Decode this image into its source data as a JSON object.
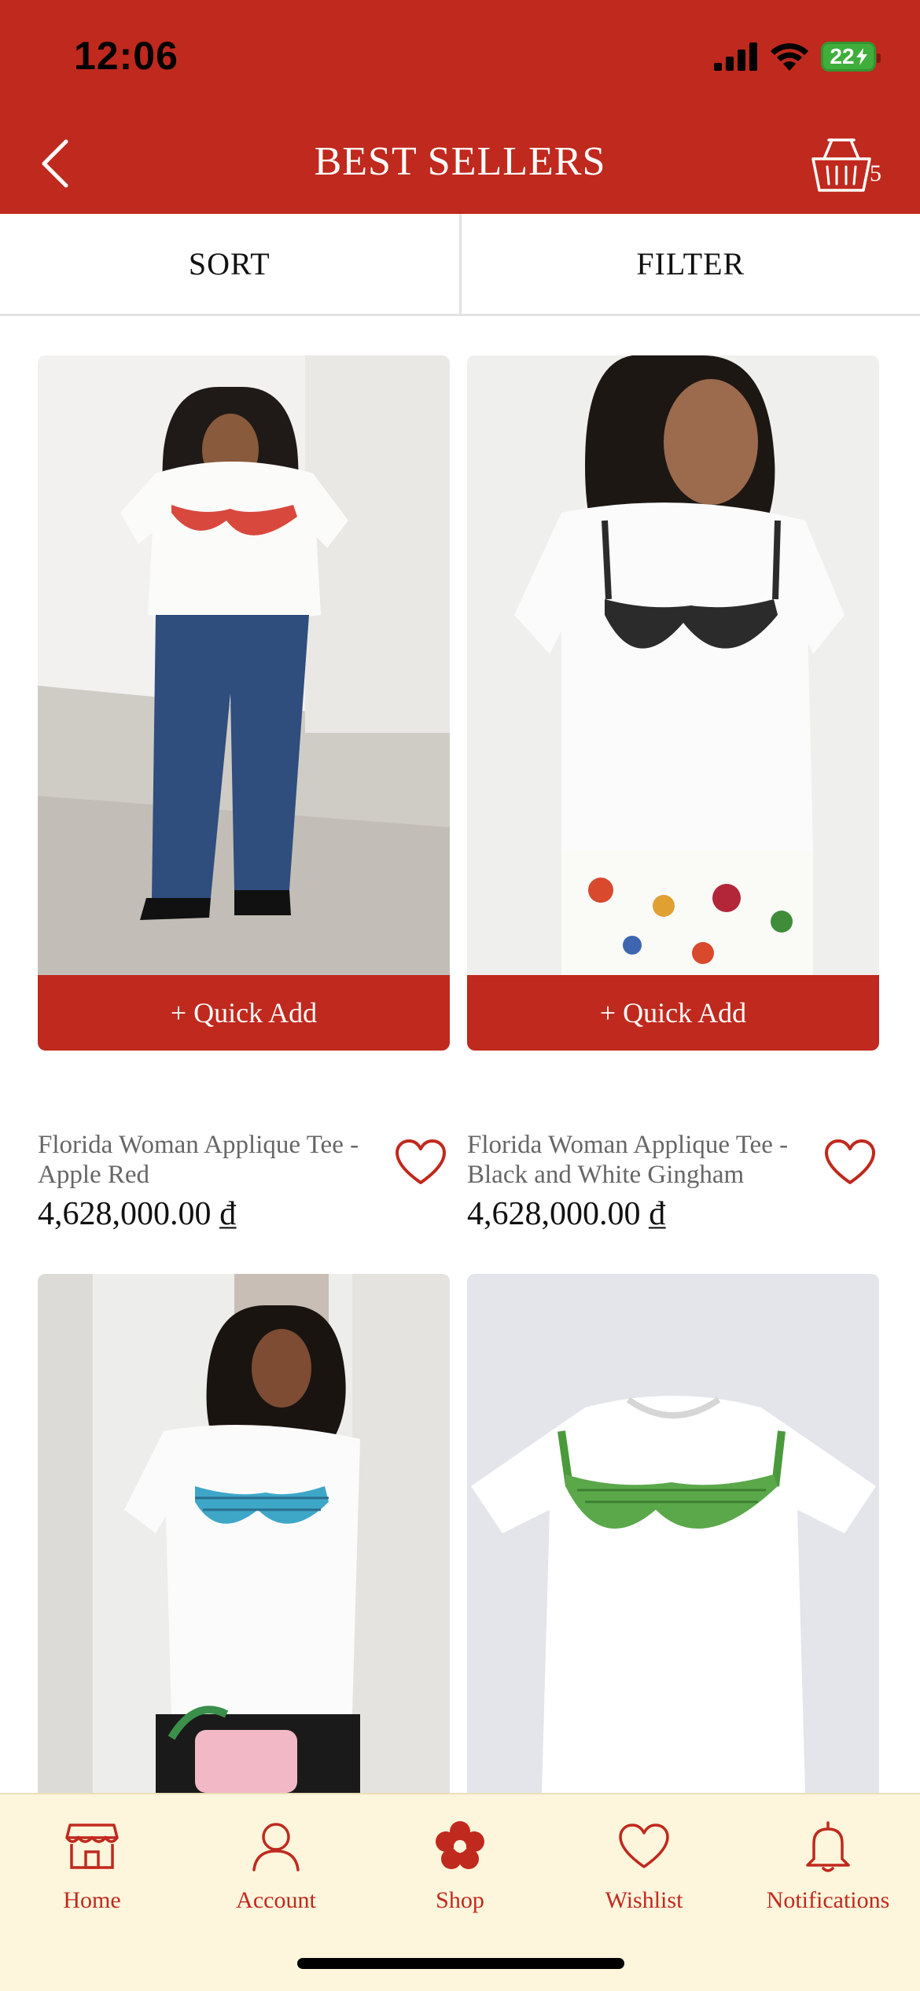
{
  "status_bar": {
    "time": "12:06",
    "battery": "22"
  },
  "header": {
    "title": "BEST SELLERS",
    "cart_count": "5"
  },
  "toolbar": {
    "sort_label": "SORT",
    "filter_label": "FILTER"
  },
  "products": [
    {
      "name": "Florida Woman Applique Tee - Apple Red",
      "price": "4,628,000.00 ₫",
      "quick_add": "+ Quick Add"
    },
    {
      "name": "Florida Woman Applique Tee - Black and White Gingham",
      "price": "4,628,000.00 ₫",
      "quick_add": "+ Quick Add"
    },
    {
      "name": "",
      "price": "",
      "quick_add": ""
    },
    {
      "name": "",
      "price": "",
      "quick_add": ""
    }
  ],
  "bottom_nav": [
    {
      "label": "Home",
      "icon": "storefront-icon"
    },
    {
      "label": "Account",
      "icon": "person-icon"
    },
    {
      "label": "Shop",
      "icon": "flower-icon"
    },
    {
      "label": "Wishlist",
      "icon": "heart-icon"
    },
    {
      "label": "Notifications",
      "icon": "bell-icon"
    }
  ],
  "colors": {
    "brand_red": "#c0291d",
    "nav_background": "#fdf5dc"
  }
}
